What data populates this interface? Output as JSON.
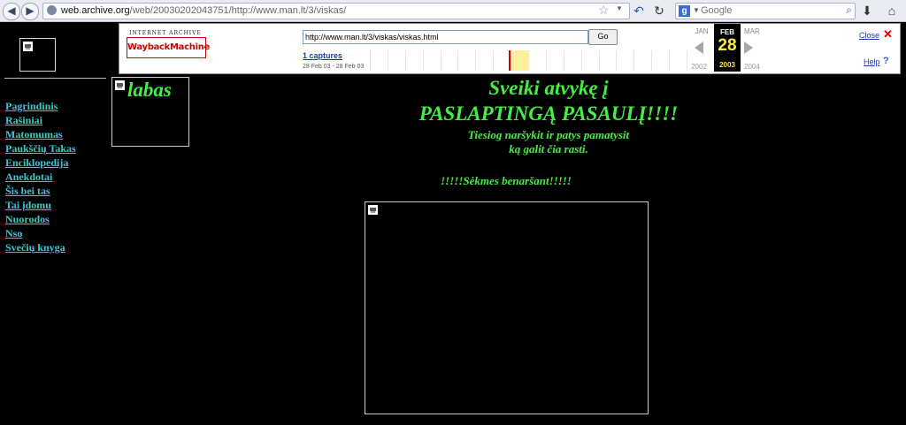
{
  "browser": {
    "url_host": "web.archive.org",
    "url_path": "/web/20030202043751/http://www.man.lt/3/viskas/",
    "search_placeholder": "Google",
    "search_engine_letter": "g"
  },
  "wayback": {
    "logo_top": "INTERNET ARCHIVE",
    "logo_main": "WaybackMachine",
    "url_value": "http://www.man.lt/3/viskas/viskas.html",
    "go_label": "Go",
    "captures": "1 captures",
    "date_range": "28 Feb 03 - 28 Feb 03",
    "prev_month": "JAN",
    "cur_month": "FEB",
    "cur_day": "28",
    "cur_year": "2003",
    "next_month": "MAR",
    "prev_year": "2002",
    "next_year": "2004",
    "close_label": "Close",
    "help_label": "Help"
  },
  "page": {
    "labas": "labas",
    "headline1": "Sveiki atvykę į",
    "headline2": "PASLAPTINGĄ PASAULĮ!!!!",
    "sub1": "Tiesiog naršykit ir patys pamatysit",
    "sub2": "ką galit čia rasti.",
    "sekmes": "!!!!!Sėkmes benaršant!!!!!",
    "nav": [
      "Pagrindinis",
      "Rašiniai",
      "Matomumas",
      "Paukščių Takas",
      "Enciklopedija",
      "Anekdotai",
      "Šis bei tas",
      "Tai įdomu",
      "Nuorodos",
      "Nso",
      "Svečių knyga"
    ]
  },
  "colors": {
    "page_bg": "#000000",
    "headline_green": "#44ee44",
    "nav_cyan": "#37c8d8"
  }
}
